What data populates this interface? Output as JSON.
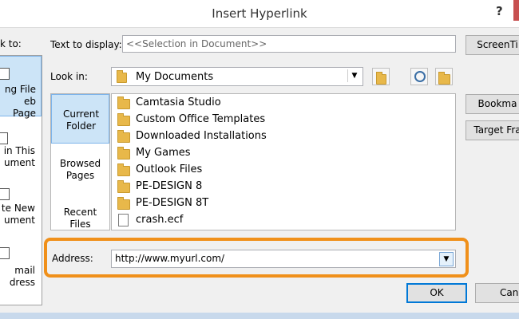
{
  "window": {
    "title": "Insert Hyperlink",
    "help": "?"
  },
  "link_to": {
    "label": "k to:",
    "items": [
      {
        "line1": "ng File",
        "line2": "eb Page",
        "selected": true
      },
      {
        "line1": "in This",
        "line2": "ument",
        "selected": false
      },
      {
        "line1": "te New",
        "line2": "ument",
        "selected": false
      },
      {
        "line1": "mail",
        "line2": "dress",
        "selected": false
      }
    ]
  },
  "text_to_display": {
    "label": "Text to display:",
    "value": "<<Selection in Document>>"
  },
  "look_in": {
    "label": "Look in:",
    "value": "My Documents"
  },
  "browse_tabs": [
    {
      "line1": "Current",
      "line2": "Folder",
      "selected": true
    },
    {
      "line1": "Browsed",
      "line2": "Pages",
      "selected": false
    },
    {
      "line1": "Recent",
      "line2": "Files",
      "selected": false
    }
  ],
  "files": [
    {
      "name": "Camtasia Studio",
      "type": "folder"
    },
    {
      "name": "Custom Office Templates",
      "type": "folder"
    },
    {
      "name": "Downloaded Installations",
      "type": "folder"
    },
    {
      "name": "My Games",
      "type": "folder"
    },
    {
      "name": "Outlook Files",
      "type": "folder"
    },
    {
      "name": "PE-DESIGN 8",
      "type": "folder"
    },
    {
      "name": "PE-DESIGN 8T",
      "type": "folder"
    },
    {
      "name": "crash.ecf",
      "type": "file"
    }
  ],
  "address": {
    "label": "Address:",
    "value": "http://www.myurl.com/"
  },
  "buttons": {
    "screentip": "ScreenTi",
    "bookmark": "Bookma",
    "target_frame": "Target Fra",
    "ok": "OK",
    "cancel": "Can"
  },
  "colors": {
    "highlight": "#f0901a",
    "selection": "#cce4f7",
    "folder": "#e8b84a"
  }
}
